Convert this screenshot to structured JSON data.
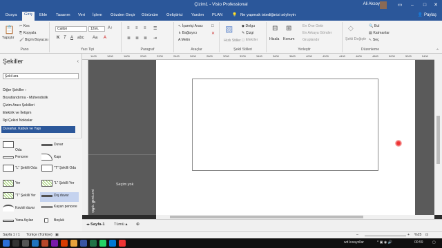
{
  "window": {
    "title": "Çizim1  -  Visio Professional",
    "user_name": "Ali Aksoy",
    "tell_me": "Ne yapmak istediğinizi söyleyin",
    "share_label": "Paylaş"
  },
  "menu": [
    "Dosya",
    "Giriş",
    "Ekle",
    "Tasarım",
    "Veri",
    "İşlem",
    "Gözden Geçir",
    "Görünüm",
    "Geliştirici",
    "Yardım",
    "PLAN"
  ],
  "ribbon": {
    "clipboard": {
      "paste": "Yapıştır",
      "cut": "Kes",
      "copy": "Kopyala",
      "format_painter": "Biçim Boyacısı",
      "label": "Pano"
    },
    "font": {
      "family": "Calibri",
      "size": "12nk.",
      "label": "Yazı Tipi"
    },
    "paragraph": {
      "label": "Paragraf"
    },
    "tools": {
      "pointer": "İşaretçi Aracı",
      "connector": "Bağlayıcı",
      "text": "Metin",
      "label": "Araçlar"
    },
    "shape_styles": {
      "quick_styles": "Hızlı Stiller",
      "fill": "Dolgu",
      "line": "Çizgi",
      "effects": "Efektler",
      "label": "Şekil Stilleri"
    },
    "arrange": {
      "align": "Hizala",
      "position": "Konum",
      "bring_front": "En Öne Getir",
      "send_back": "En Arkaya Gönder",
      "group": "Gruplandır",
      "label": "Yerleştir"
    },
    "editing": {
      "change_shape": "Şekli Değiştir",
      "find": "Bul",
      "layers": "Katmanlar",
      "select": "Seç",
      "label": "Düzenleme"
    }
  },
  "shapes_pane": {
    "title": "Şekiller",
    "search_placeholder": "Şekil ara",
    "stencils": [
      "Diğer Şekiller",
      "Boyutlandırma - Mühendislik",
      "Çizim Aracı Şekilleri",
      "Elektrik ve İletişim",
      "İlgi Çekici Noktalar",
      "Duvarlar, Kabuk ve Yapı"
    ],
    "shapes": [
      {
        "left": "Oda",
        "right": "Duvar"
      },
      {
        "left": "Pencere",
        "right": "Kapı"
      },
      {
        "left": "\"L\" Şekilli Oda",
        "right": "\"T\" Şekilli Oda"
      },
      {
        "left": "Yer",
        "right": "\"L\" Şekilli Yer"
      },
      {
        "left": "\"T\" Şekilli Yer",
        "right": "Dış duvar"
      },
      {
        "left": "Kavisli duvar",
        "right": "Kayan pencere"
      },
      {
        "left": "Yana Açılan",
        "right": "Boşluk"
      }
    ]
  },
  "ruler_ticks": [
    "1400",
    "1600",
    "1800",
    "2000",
    "2200",
    "2400",
    "2600",
    "2800",
    "3000",
    "3200",
    "3400",
    "3600",
    "3800",
    "4000",
    "4200",
    "4400",
    "4600",
    "4800",
    "5000",
    "5200",
    "5400"
  ],
  "shape_data": {
    "title": "ŞEKİL VERİLERİ",
    "empty_text": "Seçim yok"
  },
  "page_tabs": {
    "page": "Sayfa-1",
    "all": "Tümü"
  },
  "status": {
    "page": "Sayfa 1 / 1",
    "language": "Türkçe (Türkiye)",
    "zoom": "%25"
  },
  "taskbar": {
    "text": "wd kısayollar",
    "time": "00:59"
  }
}
